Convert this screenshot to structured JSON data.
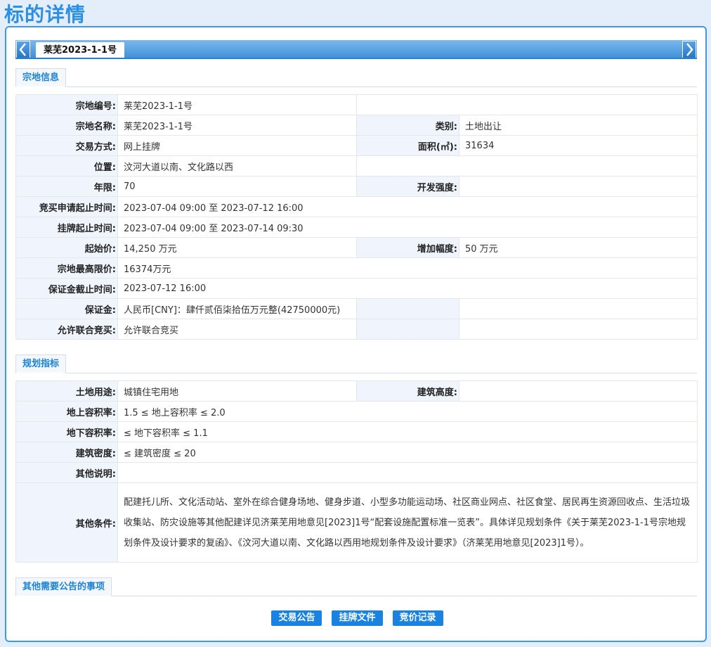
{
  "page": {
    "title": "标的详情"
  },
  "tab": {
    "label": "莱芜2023-1-1号"
  },
  "icons": {
    "prev": "chevron-left-icon",
    "next": "chevron-right-icon"
  },
  "sections": {
    "land_info": "宗地信息",
    "planning": "规划指标",
    "other_notice": "其他需要公告的事项"
  },
  "land_info": {
    "parcel_no": {
      "label": "宗地编号:",
      "value": "莱芜2023-1-1号"
    },
    "parcel_name": {
      "label": "宗地名称:",
      "value": "莱芜2023-1-1号"
    },
    "category": {
      "label": "类别:",
      "value": "土地出让"
    },
    "trade_mode": {
      "label": "交易方式:",
      "value": "网上挂牌"
    },
    "area": {
      "label": "面积(㎡):",
      "value": "31634"
    },
    "location": {
      "label": "位置:",
      "value": "汶河大道以南、文化路以西"
    },
    "term": {
      "label": "年限:",
      "value": "70"
    },
    "intensity": {
      "label": "开发强度:",
      "value": ""
    },
    "apply_period": {
      "label": "竞买申请起止时间:",
      "value": "2023-07-04 09:00 至 2023-07-12 16:00"
    },
    "listing_period": {
      "label": "挂牌起止时间:",
      "value": "2023-07-04 09:00 至 2023-07-14 09:30"
    },
    "start_price": {
      "label": "起始价:",
      "value": "14,250 万元"
    },
    "increment": {
      "label": "增加幅度:",
      "value": "50 万元"
    },
    "max_price": {
      "label": "宗地最高限价:",
      "value": "16374万元"
    },
    "deposit_deadline": {
      "label": "保证金截止时间:",
      "value": "2023-07-12 16:00"
    },
    "deposit": {
      "label": "保证金:",
      "value": "人民币[CNY]：肆仟贰佰柒拾伍万元整(42750000元)"
    },
    "joint_bid": {
      "label": "允许联合竞买:",
      "value": "允许联合竞买"
    }
  },
  "planning": {
    "land_use": {
      "label": "土地用途:",
      "value": "城镇住宅用地"
    },
    "height": {
      "label": "建筑高度:",
      "value": ""
    },
    "far_above": {
      "label": "地上容积率:",
      "value": "1.5 ≤ 地上容积率 ≤ 2.0"
    },
    "far_below": {
      "label": "地下容积率:",
      "value": "≤ 地下容积率 ≤ 1.1"
    },
    "density": {
      "label": "建筑密度:",
      "value": "≤ 建筑密度 ≤ 20"
    },
    "other_note": {
      "label": "其他说明:",
      "value": ""
    },
    "other_conditions": {
      "label": "其他条件:",
      "value": "配建托儿所、文化活动站、室外在综合健身场地、健身步道、小型多功能运动场、社区商业网点、社区食堂、居民再生资源回收点、生活垃圾收集站、防灾设施等其他配建详见济莱芜用地意见[2023]1号“配套设施配置标准一览表”。具体详见规划条件《关于莱芜2023-1-1号宗地规划条件及设计要求的复函》、《汶河大道以南、文化路以西用地规划条件及设计要求》（济莱芜用地意见[2023]1号）。"
    }
  },
  "buttons": {
    "announcement": "交易公告",
    "listing_docs": "挂牌文件",
    "bid_records": "竞价记录"
  }
}
